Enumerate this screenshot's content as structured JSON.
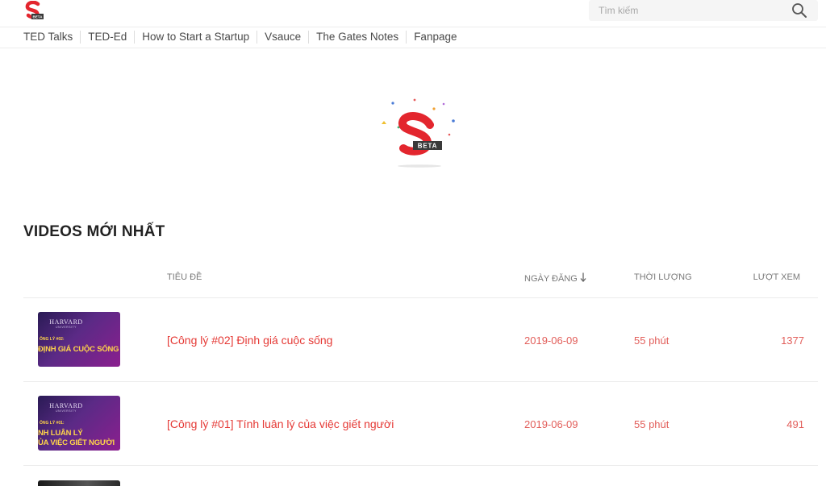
{
  "header": {
    "logo_badge": "BETA",
    "search_placeholder": "Tìm kiếm"
  },
  "nav": {
    "items": [
      "TED Talks",
      "TED-Ed",
      "How to Start a Startup",
      "Vsauce",
      "The Gates Notes",
      "Fanpage"
    ]
  },
  "hero": {
    "badge": "BETA"
  },
  "section": {
    "title": "VIDEOS MỚI NHẤT"
  },
  "table": {
    "columns": {
      "title": "TIÊU ĐỀ",
      "date": "NGÀY ĐĂNG",
      "duration": "THỜI LƯỢNG",
      "views": "LƯỢT XEM"
    },
    "rows": [
      {
        "title": "[Công lý #02] Định giá cuộc sống",
        "date": "2019-06-09",
        "duration": "55 phút",
        "views": "1377",
        "thumb": {
          "brand": "HARVARD",
          "sub": "UNIVERSITY",
          "line1": "ÔNG LÝ #02:",
          "line2": "ĐỊNH GIÁ CUỘC SỐNG"
        }
      },
      {
        "title": "[Công lý #01] Tính luân lý của việc giết người",
        "date": "2019-06-09",
        "duration": "55 phút",
        "views": "491",
        "thumb": {
          "brand": "HARVARD",
          "sub": "UNIVERSITY",
          "line1": "ÔNG LÝ #01:",
          "line2": "NH LUÂN LÝ",
          "line3": "ỦA VIỆC GIẾT NGƯỜI"
        }
      }
    ]
  },
  "colors": {
    "accent_red": "#e53935",
    "text_dark": "#222222",
    "muted": "#7a7a7a"
  }
}
